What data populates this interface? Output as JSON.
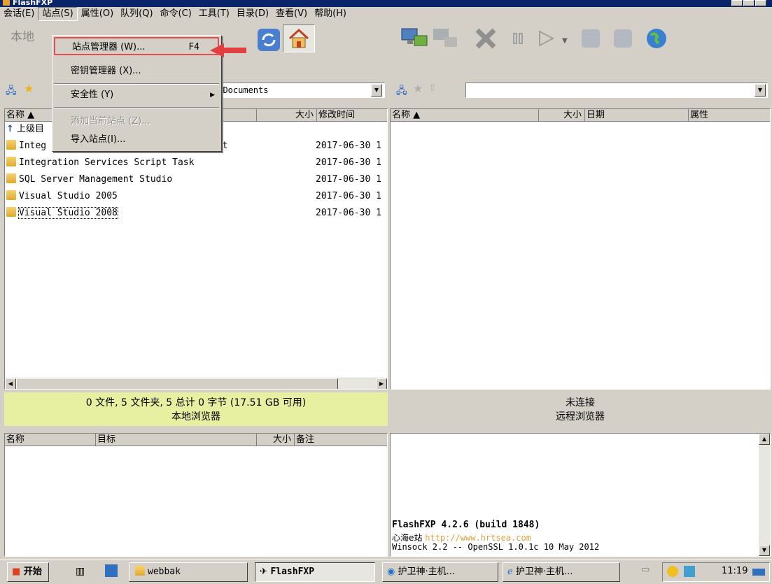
{
  "window": {
    "title": "FlashFXP",
    "accent": "#0a246a"
  },
  "menubar": [
    "会话(E)",
    "站点(S)",
    "属性(O)",
    "队列(Q)",
    "命令(C)",
    "工具(T)",
    "目录(D)",
    "查看(V)",
    "帮助(H)"
  ],
  "site_menu": {
    "items": [
      {
        "label": "站点管理器 (W)...",
        "shortcut": "F4"
      },
      {
        "label": "密钥管理器 (X)...",
        "shortcut": ""
      },
      {
        "label": "安全性 (Y)",
        "shortcut": ""
      },
      {
        "label": "添加当前站点 (Z)...",
        "shortcut": ""
      },
      {
        "label": "导入站点(I)...",
        "shortcut": ""
      }
    ]
  },
  "local": {
    "combo_label": "本地",
    "path": "r\\Documents",
    "columns": {
      "name": "名称",
      "size": "大小",
      "modified": "修改时间"
    },
    "parent_label": "上级目",
    "files": [
      {
        "name": "Integ",
        "tail": "ent",
        "date": "2017-06-30 1"
      },
      {
        "name": "Integration Services Script Task",
        "tail": "",
        "date": "2017-06-30 1"
      },
      {
        "name": "SQL Server Management Studio",
        "tail": "",
        "date": "2017-06-30 1"
      },
      {
        "name": "Visual Studio 2005",
        "tail": "",
        "date": "2017-06-30 1"
      },
      {
        "name": "Visual Studio 2008",
        "tail": "",
        "date": "2017-06-30 1"
      }
    ],
    "status_line1": "0 文件, 5 文件夹, 5 总计 0 字节 (17.51 GB 可用)",
    "status_line2": "本地浏览器",
    "status_bg": "#e6f0a0"
  },
  "remote": {
    "columns": {
      "name": "名称",
      "size": "大小",
      "date": "日期",
      "attr": "属性"
    },
    "status_line1": "未连接",
    "status_line2": "远程浏览器"
  },
  "queue": {
    "columns": {
      "name": "名称",
      "target": "目标",
      "size": "大小",
      "note": "备注"
    }
  },
  "log": {
    "line1": "FlashFXP 4.2.6 (build 1848)",
    "line2_prefix": "心海e站 ",
    "line2_url": "http://www.hrtsea.com",
    "line3": "Winsock 2.2 -- OpenSSL 1.0.1c 10 May 2012"
  },
  "taskbar": {
    "start": "开始",
    "tasks": [
      "webbak",
      "FlashFXP",
      "护卫神·主机...",
      "护卫神·主机..."
    ],
    "clock": "11:19"
  }
}
